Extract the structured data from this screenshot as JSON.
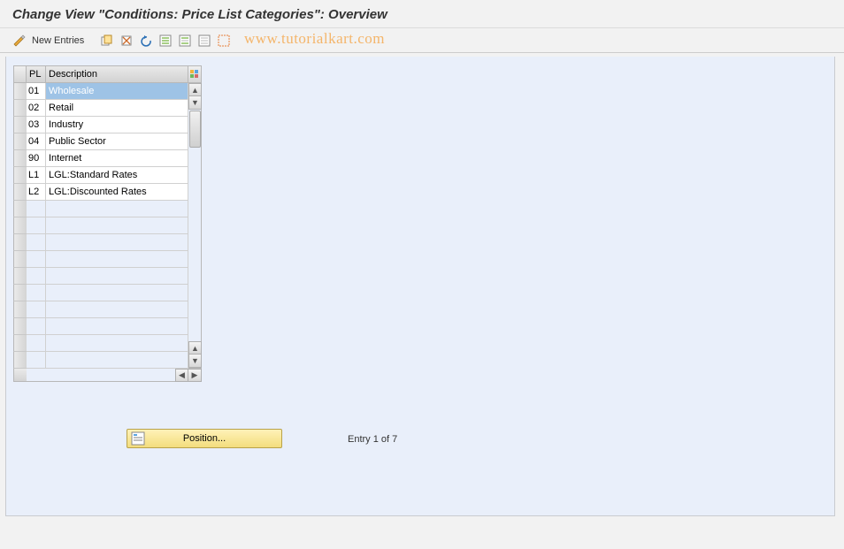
{
  "title": "Change View \"Conditions: Price List Categories\": Overview",
  "toolbar": {
    "new_entries_label": "New Entries"
  },
  "watermark": "www.tutorialkart.com",
  "grid": {
    "headers": {
      "pl": "PL",
      "desc": "Description"
    },
    "rows": [
      {
        "pl": "01",
        "desc": "Wholesale",
        "selected": true
      },
      {
        "pl": "02",
        "desc": "Retail"
      },
      {
        "pl": "03",
        "desc": "Industry"
      },
      {
        "pl": "04",
        "desc": "Public Sector"
      },
      {
        "pl": "90",
        "desc": "Internet"
      },
      {
        "pl": "L1",
        "desc": "LGL:Standard Rates"
      },
      {
        "pl": "L2",
        "desc": "LGL:Discounted Rates"
      }
    ],
    "empty_rows": 10
  },
  "footer": {
    "position_label": "Position...",
    "entry_status": "Entry 1 of 7"
  }
}
